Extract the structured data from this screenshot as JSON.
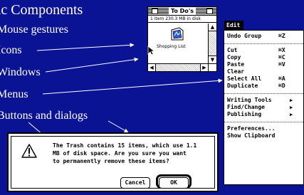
{
  "slide": {
    "title": "sic Components",
    "bullets": [
      "Mouse gestures",
      "Icons",
      "Windows",
      "Menus",
      "Buttons and dialogs"
    ]
  },
  "finder_window": {
    "title": "To Do's",
    "info": "1 item  230.3 MB in disk",
    "file_label": "Shopping List",
    "file_icon": "document-icon"
  },
  "edit_menu": {
    "title": "Edit",
    "items": [
      {
        "label": "Undo Group",
        "shortcut": "⌘Z"
      },
      {
        "label": "Cut",
        "shortcut": "⌘X"
      },
      {
        "label": "Copy",
        "shortcut": "⌘C"
      },
      {
        "label": "Paste",
        "shortcut": "⌘V"
      },
      {
        "label": "Clear",
        "shortcut": ""
      },
      {
        "label": "Select All",
        "shortcut": "⌘A"
      },
      {
        "label": "Duplicate",
        "shortcut": "⌘D"
      },
      {
        "label": "Writing Tools",
        "shortcut": "▶"
      },
      {
        "label": "Find/Change",
        "shortcut": "▶"
      },
      {
        "label": "Publishing",
        "shortcut": "▶"
      },
      {
        "label": "Preferences...",
        "shortcut": ""
      },
      {
        "label": "Show Clipboard",
        "shortcut": ""
      }
    ]
  },
  "alert": {
    "message_line1": "The Trash contains 15 items, which use 1.1",
    "message_line2": "MB of disk space.  Are you sure you want",
    "message_line3": "to permanently remove these items?",
    "cancel_label": "Cancel",
    "ok_label": "OK",
    "icon": "caution-icon"
  },
  "colors": {
    "background": "#0a1394",
    "text": "#ffffff"
  }
}
